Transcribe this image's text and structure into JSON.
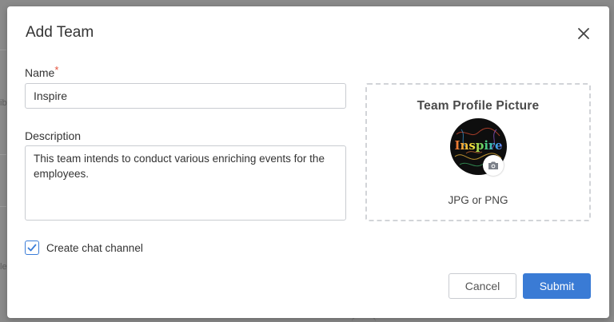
{
  "modal": {
    "title": "Add Team"
  },
  "form": {
    "name_label": "Name",
    "name_required_marker": "*",
    "name_value": "Inspire",
    "description_label": "Description",
    "description_value": "This team intends to conduct various enriching events for the employees.",
    "create_chat_label": "Create chat channel",
    "create_chat_checked": true
  },
  "picture": {
    "title": "Team Profile Picture",
    "avatar_text": "Inspire",
    "hint": "JPG or PNG"
  },
  "actions": {
    "cancel_label": "Cancel",
    "submit_label": "Submit"
  },
  "background": {
    "fragments": [
      "ib",
      "le"
    ]
  },
  "colors": {
    "primary": "#3a7bd5",
    "required": "#e5533d",
    "overlay": "#7f7f7f"
  },
  "icons": [
    "close-icon",
    "checkmark-icon",
    "camera-icon"
  ]
}
